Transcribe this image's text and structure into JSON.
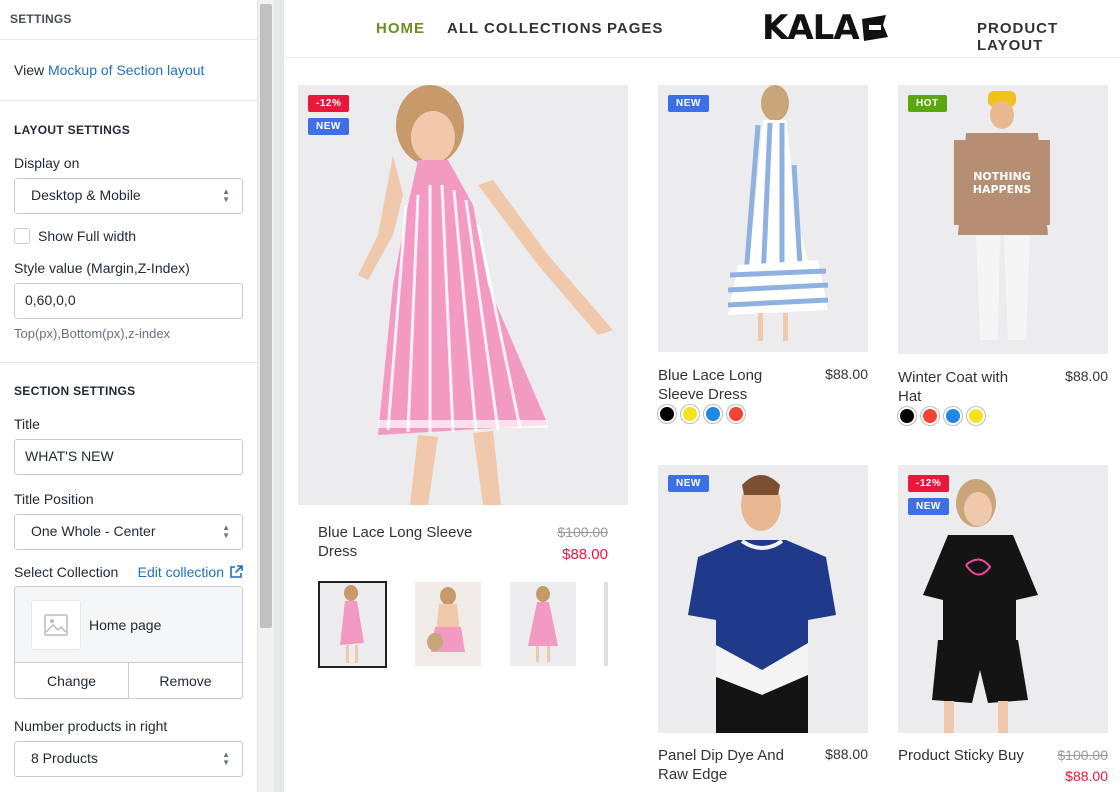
{
  "panel": {
    "header": "SETTINGS",
    "view_prefix": "View",
    "view_link": "Mockup of Section layout",
    "layout": {
      "title": "LAYOUT SETTINGS",
      "display_label": "Display on",
      "display_value": "Desktop & Mobile",
      "fullwidth_label": "Show Full width",
      "style_label": "Style value (Margin,Z-Index)",
      "style_value": "0,60,0,0",
      "style_hint": "Top(px),Bottom(px),z-index"
    },
    "section": {
      "title": "SECTION SETTINGS",
      "title_label": "Title",
      "title_value": "WHAT'S NEW",
      "position_label": "Title Position",
      "position_value": "One Whole - Center",
      "collection_label": "Select Collection",
      "edit_collection": "Edit collection",
      "collection_name": "Home page",
      "change": "Change",
      "remove": "Remove",
      "number_label": "Number products in right",
      "number_value": "8 Products"
    }
  },
  "nav": {
    "home": "HOME",
    "collections": "ALL COLLECTIONS",
    "pages": "PAGES",
    "logo": "KALA",
    "product_layout": "PRODUCT LAYOUT"
  },
  "colors": {
    "accent": "#6b8e23",
    "sale": "#e8173c",
    "new": "#3d6fe6",
    "hot": "#5aa80e",
    "link": "#1f6fc4"
  },
  "products": {
    "featured": {
      "badges": [
        "-12%",
        "NEW"
      ],
      "name": "Blue Lace Long Sleeve Dress",
      "old_price": "$100.00",
      "price": "$88.00"
    },
    "p1": {
      "badge": "NEW",
      "name": "Blue Lace Long Sleeve Dress",
      "price": "$88.00",
      "swatches": [
        "#000000",
        "#f5e31c",
        "#1e88e5",
        "#f44336"
      ]
    },
    "p2": {
      "badge": "HOT",
      "name": "Winter Coat with Hat",
      "price": "$88.00",
      "swatches": [
        "#000000",
        "#f44336",
        "#1e88e5",
        "#f5e31c"
      ]
    },
    "p3": {
      "badge": "NEW",
      "name": "Panel Dip Dye And Raw Edge",
      "price": "$88.00"
    },
    "p4": {
      "badges": [
        "-12%",
        "NEW"
      ],
      "name": "Product Sticky Buy",
      "old_price": "$100.00",
      "price": "$88.00"
    }
  }
}
